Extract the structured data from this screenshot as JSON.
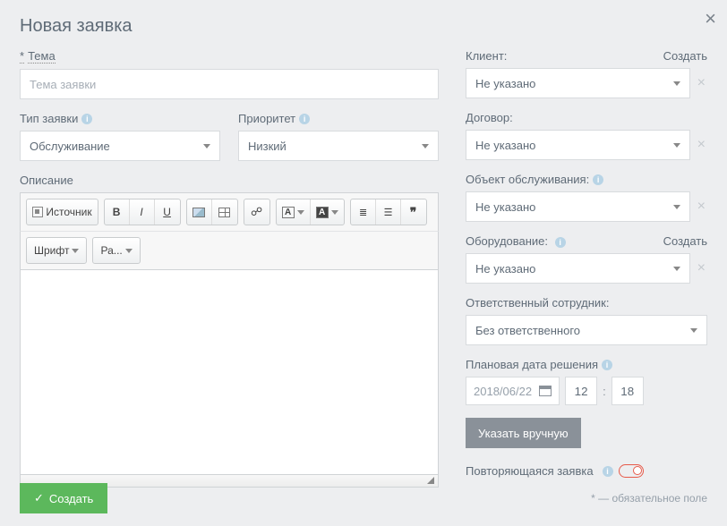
{
  "header": {
    "title": "Новая заявка"
  },
  "left": {
    "subject": {
      "label": "Тема",
      "required": "*",
      "placeholder": "Тема заявки"
    },
    "type": {
      "label": "Тип заявки",
      "value": "Обслуживание"
    },
    "priority": {
      "label": "Приоритет",
      "value": "Низкий"
    },
    "description": {
      "label": "Описание"
    },
    "toolbar": {
      "source": "Источник",
      "bold": "B",
      "italic": "I",
      "underline": "U",
      "font": "Шрифт",
      "size": "Ра..."
    }
  },
  "right": {
    "client": {
      "label": "Клиент:",
      "create": "Создать",
      "value": "Не указано"
    },
    "contract": {
      "label": "Договор:",
      "value": "Не указано"
    },
    "object": {
      "label": "Объект обслуживания:",
      "value": "Не указано"
    },
    "equipment": {
      "label": "Оборудование:",
      "create": "Создать",
      "value": "Не указано"
    },
    "responsible": {
      "label": "Ответственный сотрудник:",
      "value": "Без ответственного"
    },
    "planned": {
      "label": "Плановая дата решения",
      "date": "2018/06/22",
      "hour": "12",
      "minute": "18"
    },
    "manual": "Указать вручную",
    "recurring": {
      "label": "Повторяющаяся заявка"
    }
  },
  "footer": {
    "submit": "Создать",
    "note": "* — обязательное поле"
  }
}
